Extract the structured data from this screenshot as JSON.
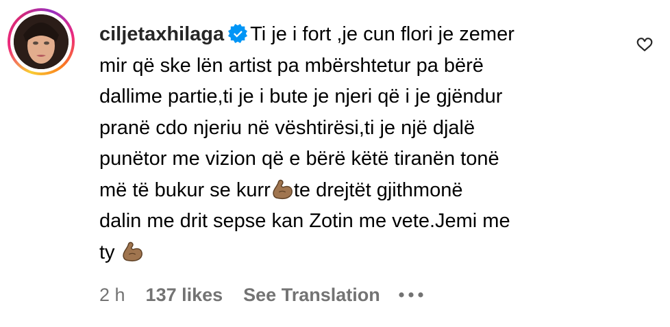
{
  "comment": {
    "username": "ciljetaxhilaga",
    "verified": true,
    "text_lines": [
      "Ti je i fort ,je cun flori je zemer",
      "mir që ske lën artist pa mbërshtetur pa bërë",
      "dallime partie,ti je i bute je njeri që i je gjëndur",
      "pranë cdo njeriu në vështirësi,ti je një djalë",
      "punëtor me vizion që e bërë këtë tiranën tonë",
      "më të bukur se kurr",
      "te drejtët gjithmonë",
      "dalin me drit sepse kan Zotin me vete.Jemi me",
      "ty "
    ],
    "emoji": "flexed-biceps-medium-dark"
  },
  "meta": {
    "time": "2 h",
    "likes": "137 likes",
    "translate": "See Translation"
  },
  "colors": {
    "text": "#000000",
    "secondary": "#737373",
    "verified": "#0095f6"
  },
  "icons": {
    "verified": "verified-badge-icon",
    "emoji": "flexed-biceps-emoji-icon",
    "like": "heart-outline-icon",
    "more": "more-dots-icon"
  }
}
